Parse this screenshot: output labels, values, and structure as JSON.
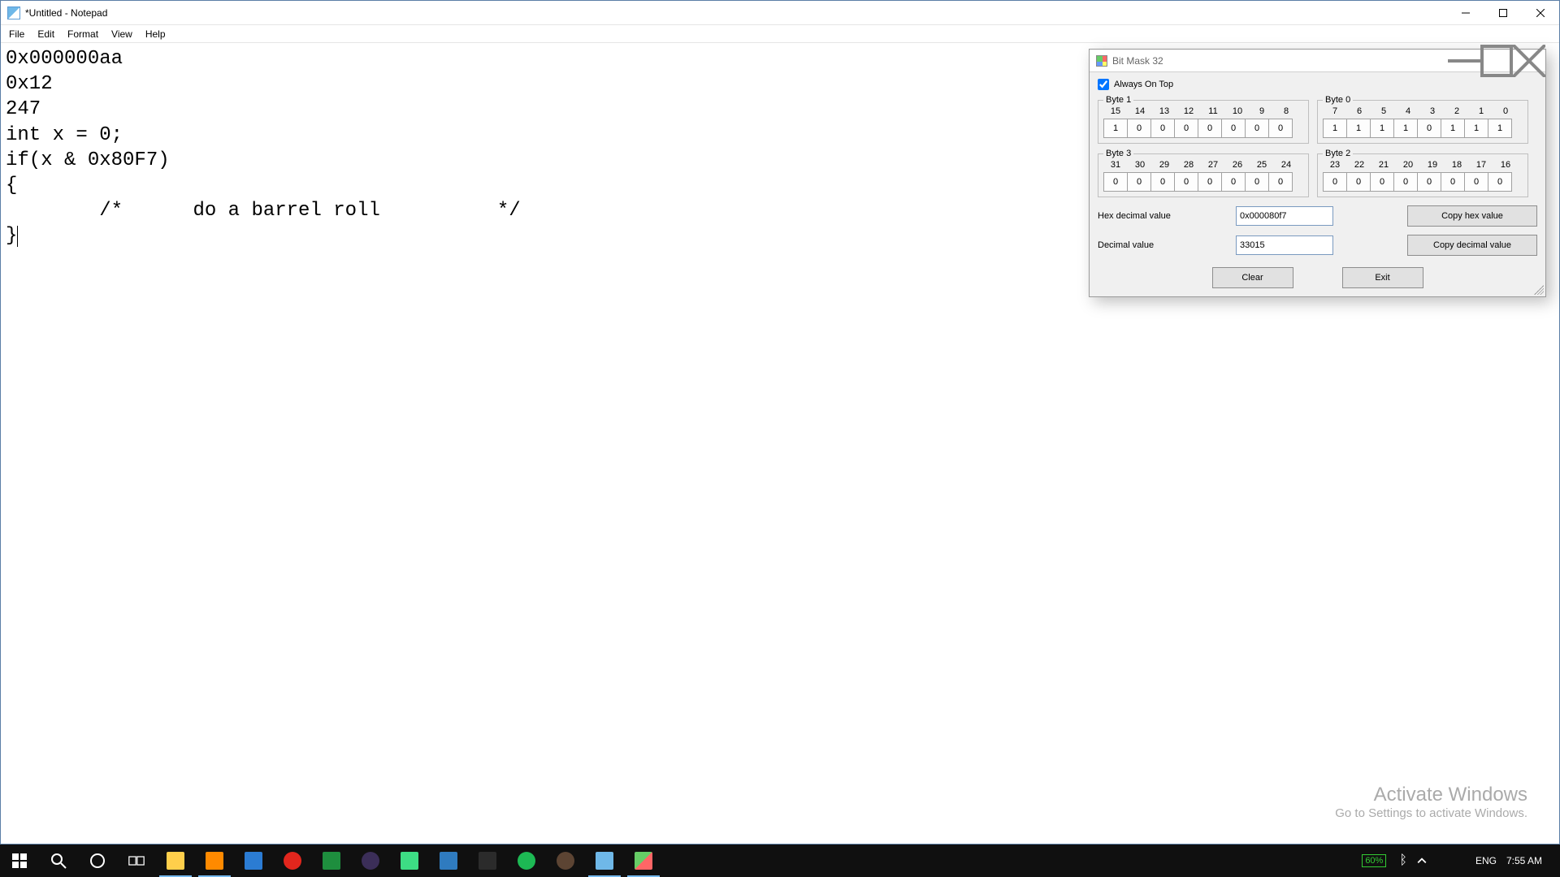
{
  "notepad": {
    "title": "*Untitled - Notepad",
    "menu": [
      "File",
      "Edit",
      "Format",
      "View",
      "Help"
    ],
    "content": "0x000000aa\n0x12\n247\nint x = 0;\nif(x & 0x80F7)\n{\n        /*      do a barrel roll          */\n}"
  },
  "bitmask": {
    "title": "Bit Mask 32",
    "always_on_top_label": "Always On Top",
    "always_on_top_checked": true,
    "bytes": [
      {
        "label": "Byte 1",
        "bits": [
          "15",
          "14",
          "13",
          "12",
          "11",
          "10",
          "9",
          "8"
        ],
        "vals": [
          "1",
          "0",
          "0",
          "0",
          "0",
          "0",
          "0",
          "0"
        ]
      },
      {
        "label": "Byte 0",
        "bits": [
          "7",
          "6",
          "5",
          "4",
          "3",
          "2",
          "1",
          "0"
        ],
        "vals": [
          "1",
          "1",
          "1",
          "1",
          "0",
          "1",
          "1",
          "1"
        ]
      },
      {
        "label": "Byte 3",
        "bits": [
          "31",
          "30",
          "29",
          "28",
          "27",
          "26",
          "25",
          "24"
        ],
        "vals": [
          "0",
          "0",
          "0",
          "0",
          "0",
          "0",
          "0",
          "0"
        ]
      },
      {
        "label": "Byte 2",
        "bits": [
          "23",
          "22",
          "21",
          "20",
          "19",
          "18",
          "17",
          "16"
        ],
        "vals": [
          "0",
          "0",
          "0",
          "0",
          "0",
          "0",
          "0",
          "0"
        ]
      }
    ],
    "hex_label": "Hex decimal value",
    "hex_value": "0x000080f7",
    "copy_hex_label": "Copy hex value",
    "dec_label": "Decimal value",
    "dec_value": "33015",
    "copy_dec_label": "Copy decimal value",
    "clear_label": "Clear",
    "exit_label": "Exit"
  },
  "watermark": {
    "line1": "Activate Windows",
    "line2": "Go to Settings to activate Windows."
  },
  "taskbar": {
    "battery_pct": "60%",
    "lang": "ENG",
    "time": "7:55 AM"
  }
}
